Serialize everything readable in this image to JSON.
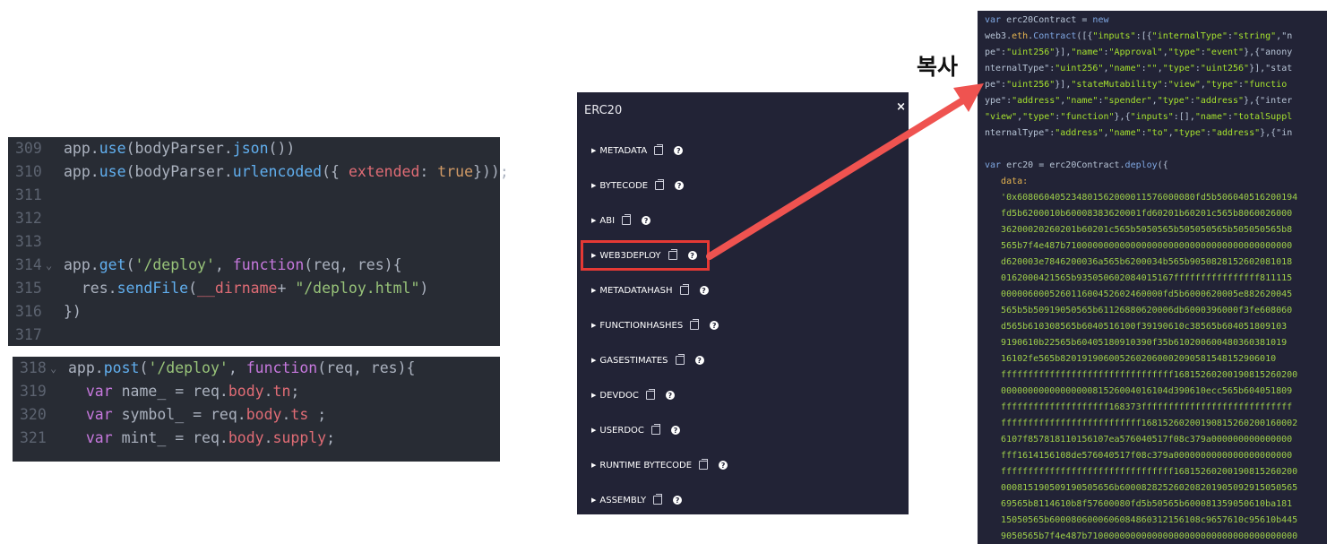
{
  "editor_top": {
    "lines": [
      {
        "num": "309",
        "fold": false,
        "code": [
          [
            "app.",
            "p"
          ],
          [
            "use",
            "fn"
          ],
          [
            "(bodyParser.",
            "p"
          ],
          [
            "json",
            "fn"
          ],
          [
            "())",
            "p"
          ]
        ]
      },
      {
        "num": "310",
        "fold": false,
        "code": [
          [
            "app.",
            "p"
          ],
          [
            "use",
            "fn"
          ],
          [
            "(bodyParser.",
            "p"
          ],
          [
            "urlencoded",
            "fn"
          ],
          [
            "({ ",
            "p"
          ],
          [
            "extended",
            "prop"
          ],
          [
            ": ",
            "p"
          ],
          [
            "true",
            "bool"
          ],
          [
            "}));",
            "p"
          ]
        ]
      },
      {
        "num": "311",
        "fold": false,
        "code": []
      },
      {
        "num": "312",
        "fold": false,
        "code": []
      },
      {
        "num": "313",
        "fold": false,
        "code": []
      },
      {
        "num": "314",
        "fold": true,
        "code": [
          [
            "app.",
            "p"
          ],
          [
            "get",
            "fn"
          ],
          [
            "(",
            "p"
          ],
          [
            "'/deploy'",
            "str"
          ],
          [
            ", ",
            "p"
          ],
          [
            "function",
            "kw"
          ],
          [
            "(req, res){",
            "p"
          ]
        ]
      },
      {
        "num": "315",
        "fold": false,
        "code": [
          [
            "  res.",
            "p"
          ],
          [
            "sendFile",
            "fn"
          ],
          [
            "(",
            "p"
          ],
          [
            "__dirname",
            "var"
          ],
          [
            "+ ",
            "p"
          ],
          [
            "\"/deploy.html\"",
            "str"
          ],
          [
            ")",
            "p"
          ]
        ]
      },
      {
        "num": "316",
        "fold": false,
        "code": [
          [
            "})",
            "p"
          ]
        ]
      },
      {
        "num": "317",
        "fold": false,
        "code": []
      }
    ]
  },
  "editor_bottom": {
    "lines": [
      {
        "num": "318",
        "fold": true,
        "code": [
          [
            "app.",
            "p"
          ],
          [
            "post",
            "fn"
          ],
          [
            "(",
            "p"
          ],
          [
            "'/deploy'",
            "str"
          ],
          [
            ", ",
            "p"
          ],
          [
            "function",
            "kw"
          ],
          [
            "(req, res){",
            "p"
          ]
        ]
      },
      {
        "num": "319",
        "fold": false,
        "code": [
          [
            "  ",
            "p"
          ],
          [
            "var",
            "kw"
          ],
          [
            " name_ = req.",
            "p"
          ],
          [
            "body",
            "prop"
          ],
          [
            ".",
            "p"
          ],
          [
            "tn",
            "prop"
          ],
          [
            ";",
            "p"
          ]
        ]
      },
      {
        "num": "320",
        "fold": false,
        "code": [
          [
            "  ",
            "p"
          ],
          [
            "var",
            "kw"
          ],
          [
            " symbol_ = req.",
            "p"
          ],
          [
            "body",
            "prop"
          ],
          [
            ".",
            "p"
          ],
          [
            "ts",
            "prop"
          ],
          [
            " ;",
            "p"
          ]
        ]
      },
      {
        "num": "321",
        "fold": false,
        "code": [
          [
            "  ",
            "p"
          ],
          [
            "var",
            "kw"
          ],
          [
            " mint_ = req.",
            "p"
          ],
          [
            "body",
            "prop"
          ],
          [
            ".",
            "p"
          ],
          [
            "supply",
            "prop"
          ],
          [
            ";",
            "p"
          ]
        ]
      }
    ]
  },
  "panel": {
    "title": "ERC20",
    "close": "×",
    "items": [
      {
        "label": "METADATA",
        "highlighted": false
      },
      {
        "label": "BYTECODE",
        "highlighted": false
      },
      {
        "label": "ABI",
        "highlighted": false
      },
      {
        "label": "WEB3DEPLOY",
        "highlighted": true
      },
      {
        "label": "METADATAHASH",
        "highlighted": false
      },
      {
        "label": "FUNCTIONHASHES",
        "highlighted": false
      },
      {
        "label": "GASESTIMATES",
        "highlighted": false
      },
      {
        "label": "DEVDOC",
        "highlighted": false
      },
      {
        "label": "USERDOC",
        "highlighted": false
      },
      {
        "label": "RUNTIME BYTECODE",
        "highlighted": false
      },
      {
        "label": "ASSEMBLY",
        "highlighted": false
      }
    ]
  },
  "annotation": {
    "label": "복사",
    "color": "#ef5350"
  },
  "output_code": {
    "lines": [
      [
        [
          "var",
          "kw"
        ],
        [
          " erc20Contract = ",
          "plain"
        ],
        [
          "new",
          "kw"
        ]
      ],
      [
        [
          "web3.",
          "plain"
        ],
        [
          "eth",
          "prop"
        ],
        [
          ".",
          "plain"
        ],
        [
          "Contract",
          "kw"
        ],
        [
          "([{",
          "plain"
        ],
        [
          "\"inputs\"",
          "str"
        ],
        [
          ":[{",
          "plain"
        ],
        [
          "\"internalType\"",
          "str"
        ],
        [
          ":",
          "plain"
        ],
        [
          "\"string\"",
          "str"
        ],
        [
          ",\"n",
          "plain"
        ]
      ],
      [
        [
          "pe\":",
          "plain"
        ],
        [
          "\"uint256\"",
          "str"
        ],
        [
          "}],",
          "plain"
        ],
        [
          "\"name\"",
          "str"
        ],
        [
          ":",
          "plain"
        ],
        [
          "\"Approval\"",
          "str"
        ],
        [
          ",",
          "plain"
        ],
        [
          "\"type\"",
          "str"
        ],
        [
          ":",
          "plain"
        ],
        [
          "\"event\"",
          "str"
        ],
        [
          "},{\"anony",
          "plain"
        ]
      ],
      [
        [
          "nternalType\":",
          "plain"
        ],
        [
          "\"uint256\"",
          "str"
        ],
        [
          ",",
          "plain"
        ],
        [
          "\"name\"",
          "str"
        ],
        [
          ":",
          "plain"
        ],
        [
          "\"\"",
          "str"
        ],
        [
          ",",
          "plain"
        ],
        [
          "\"type\"",
          "str"
        ],
        [
          ":",
          "plain"
        ],
        [
          "\"uint256\"",
          "str"
        ],
        [
          "}],\"stat",
          "plain"
        ]
      ],
      [
        [
          "pe\":",
          "plain"
        ],
        [
          "\"uint256\"",
          "str"
        ],
        [
          "}],",
          "plain"
        ],
        [
          "\"stateMutability\"",
          "str"
        ],
        [
          ":",
          "plain"
        ],
        [
          "\"view\"",
          "str"
        ],
        [
          ",",
          "plain"
        ],
        [
          "\"type\"",
          "str"
        ],
        [
          ":",
          "plain"
        ],
        [
          "\"functio",
          "str"
        ]
      ],
      [
        [
          "ype\":",
          "plain"
        ],
        [
          "\"address\"",
          "str"
        ],
        [
          ",",
          "plain"
        ],
        [
          "\"name\"",
          "str"
        ],
        [
          ":",
          "plain"
        ],
        [
          "\"spender\"",
          "str"
        ],
        [
          ",",
          "plain"
        ],
        [
          "\"type\"",
          "str"
        ],
        [
          ":",
          "plain"
        ],
        [
          "\"address\"",
          "str"
        ],
        [
          "},{\"inter",
          "plain"
        ]
      ],
      [
        [
          "\"view\"",
          "str"
        ],
        [
          ",",
          "plain"
        ],
        [
          "\"type\"",
          "str"
        ],
        [
          ":",
          "plain"
        ],
        [
          "\"function\"",
          "str"
        ],
        [
          "},{",
          "plain"
        ],
        [
          "\"inputs\"",
          "str"
        ],
        [
          ":[],",
          "plain"
        ],
        [
          "\"name\"",
          "str"
        ],
        [
          ":",
          "plain"
        ],
        [
          "\"totalSuppl",
          "str"
        ]
      ],
      [
        [
          "nternalType\":",
          "plain"
        ],
        [
          "\"address\"",
          "str"
        ],
        [
          ",",
          "plain"
        ],
        [
          "\"name\"",
          "str"
        ],
        [
          ":",
          "plain"
        ],
        [
          "\"to\"",
          "str"
        ],
        [
          ",",
          "plain"
        ],
        [
          "\"type\"",
          "str"
        ],
        [
          ":",
          "plain"
        ],
        [
          "\"address\"",
          "str"
        ],
        [
          "},{\"in",
          "plain"
        ]
      ],
      [],
      [
        [
          "var",
          "kw"
        ],
        [
          " erc20 = erc20Contract.",
          "plain"
        ],
        [
          "deploy",
          "kw"
        ],
        [
          "({",
          "plain"
        ]
      ],
      [
        [
          "   data:",
          "prop"
        ]
      ],
      [
        [
          "   '0x608060405234801562000011576000080fd5b506040516200194",
          "hex"
        ]
      ],
      [
        [
          "   fd5b6200010b60008383620001fd60201b60201c565b8060026000",
          "hex"
        ]
      ],
      [
        [
          "   36200020260201b60201c565b5050565b505050565b505050565b8",
          "hex"
        ]
      ],
      [
        [
          "   565b7f4e487b710000000000000000000000000000000000000000",
          "hex"
        ]
      ],
      [
        [
          "   d620003e7846200036a565b6200034b565b9050828152602081018",
          "hex"
        ]
      ],
      [
        [
          "   0162000421565b935050602084015167ffffffffffffffff811115",
          "hex"
        ]
      ],
      [
        [
          "   000006000526011600452602460000fd5b6000620005e882620045",
          "hex"
        ]
      ],
      [
        [
          "   565b5b50919050565b61126880620006db6000396000f3fe608060",
          "hex"
        ]
      ],
      [
        [
          "   d565b610308565b6040516100f39190610c38565b604051809103",
          "hex"
        ]
      ],
      [
        [
          "   9190610b22565b60405180910390f35b610200600480360381019",
          "hex"
        ]
      ],
      [
        [
          "   16102fe565b8201919060052602060002090581548152906010",
          "hex"
        ]
      ],
      [
        [
          "   ffffffffffffffffffffffffffffffff16815260200190815260200",
          "hex"
        ]
      ],
      [
        [
          "   0000000000000000081526004016104d390610ecc565b604051809",
          "hex"
        ]
      ],
      [
        [
          "   ffffffffffffffffffff168373ffffffffffffffffffffffffffff",
          "hex"
        ]
      ],
      [
        [
          "   ffffffffffffffffffffffffff16815260200190815260200160002",
          "hex"
        ]
      ],
      [
        [
          "   6107f857818110156107ea576040517f08c379a000000000000000",
          "hex"
        ]
      ],
      [
        [
          "   fff1614156108de576040517f08c379a0000000000000000000000",
          "hex"
        ]
      ],
      [
        [
          "   ffffffffffffffffffffffffffffffff16815260200190815260200",
          "hex"
        ]
      ],
      [
        [
          "   000815190509190505656b600082825260208201905092915050565",
          "hex"
        ]
      ],
      [
        [
          "   69565b8114610b8f57600080fd5b50565b600081359050610ba181",
          "hex"
        ]
      ],
      [
        [
          "   15050565b6000806000606084860312156108c9657610c95610b445",
          "hex"
        ]
      ],
      [
        [
          "   9050565b7f4e487b710000000000000000000000000000000000000",
          "hex"
        ]
      ]
    ]
  }
}
